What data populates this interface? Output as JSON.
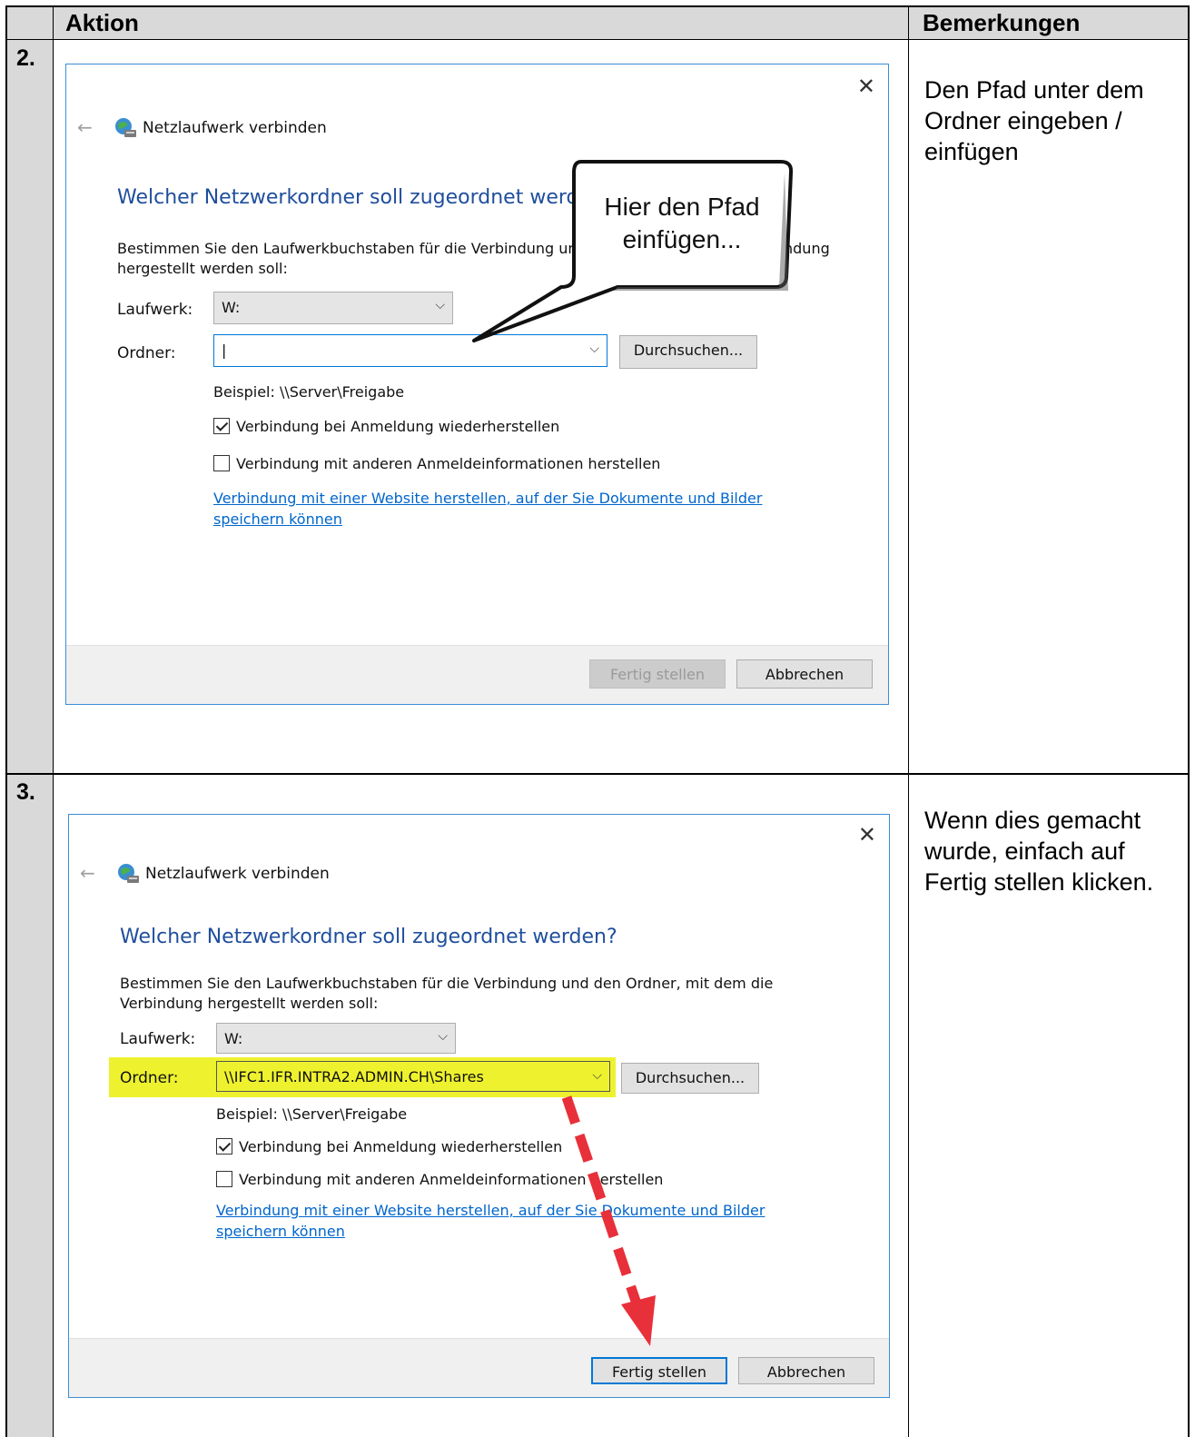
{
  "table": {
    "headers": [
      "Aktion",
      "Bemerkungen"
    ]
  },
  "rows": [
    {
      "num": "2.",
      "remark": "Den Pfad unter dem Ordner eingeben / einfügen",
      "dialog": {
        "title": "Netzlaufwerk verbinden",
        "question": "Welcher Netzwerkordner soll zugeordnet werden",
        "description_line1": "Bestimmen Sie den Laufwerkbuchstaben für die Verbindung und",
        "description_tail": "ndung",
        "description_line2": "hergestellt werden soll:",
        "drive_label": "Laufwerk:",
        "drive_value": "W:",
        "folder_label": "Ordner:",
        "folder_value": "|",
        "browse_label": "Durchsuchen...",
        "example": "Beispiel: \\\\Server\\Freigabe",
        "reconnect_label": "Verbindung bei Anmeldung wiederherstellen",
        "reconnect_checked": true,
        "credentials_label": "Verbindung mit anderen Anmeldeinformationen herstellen",
        "credentials_checked": false,
        "link_text": "Verbindung mit einer Website herstellen, auf der Sie Dokumente und Bilder speichern können",
        "finish_label": "Fertig stellen",
        "cancel_label": "Abbrechen"
      },
      "callout": "Hier den Pfad einfügen..."
    },
    {
      "num": "3.",
      "remark": "Wenn dies gemacht wurde, einfach auf Fertig stellen klicken.",
      "dialog": {
        "title": "Netzlaufwerk verbinden",
        "question": "Welcher Netzwerkordner soll zugeordnet werden?",
        "description": "Bestimmen Sie den Laufwerkbuchstaben für die Verbindung und den Ordner, mit dem die Verbindung hergestellt werden soll:",
        "drive_label": "Laufwerk:",
        "drive_value": "W:",
        "folder_label": "Ordner:",
        "folder_value": "\\\\IFC1.IFR.INTRA2.ADMIN.CH\\Shares",
        "browse_label": "Durchsuchen...",
        "example": "Beispiel: \\\\Server\\Freigabe",
        "reconnect_label": "Verbindung bei Anmeldung wiederherstellen",
        "reconnect_checked": true,
        "credentials_label": "Verbindung mit anderen Anmeldeinformationen herstellen",
        "credentials_checked": false,
        "link_text": "Verbindung mit einer Website herstellen, auf der Sie Dokumente und Bilder speichern können",
        "finish_label": "Fertig stellen",
        "cancel_label": "Abbrechen"
      }
    }
  ],
  "colors": {
    "header_shade": "#d9d9d9",
    "dialog_accent": "#0078d7",
    "question_blue": "#1f4e9c",
    "highlight": "#eef22e",
    "arrow_red": "#e8303a"
  },
  "icons": {
    "close": "close-icon",
    "back": "back-arrow-icon",
    "network": "network-drive-icon",
    "chevron": "chevron-down-icon"
  }
}
